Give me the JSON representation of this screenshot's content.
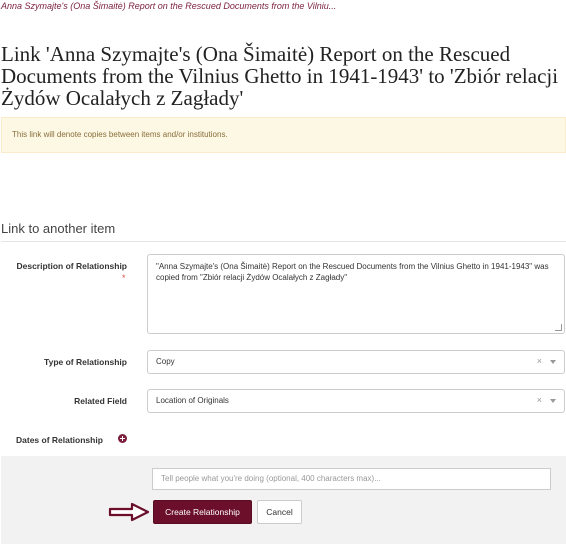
{
  "breadcrumb": "Anna Szymajte's (Ona Šimaitė) Report on the Rescued Documents from the Vilniu...",
  "page_title": "Link 'Anna Szymajte's (Ona Šimaitė) Report on the Rescued Documents from the Vilnius Ghetto in 1941-1943' to 'Zbiór relacji Żydów Ocalałych z Zagłady'",
  "alert_text": "This link will denote copies between items and/or institutions.",
  "section_heading": "Link to another item",
  "form": {
    "description_label": "Description of Relationship",
    "required_marker": "*",
    "description_value": "\"Anna Szymajte's (Ona Šimaitė) Report on the Rescued Documents from the Vilnius Ghetto in 1941-1943\" was copied from \"Zbiór relacji Żydów Ocalałych z Zagłady\"",
    "type_label": "Type of Relationship",
    "type_value": "Copy",
    "related_field_label": "Related Field",
    "related_field_value": "Location of Originals",
    "dates_label": "Dates of Relationship",
    "clear_glyph": "×"
  },
  "footer": {
    "log_placeholder": "Tell people what you're doing (optional, 400 characters max)...",
    "create_button": "Create Relationship",
    "cancel_button": "Cancel"
  },
  "colors": {
    "brand": "#6b0f2a",
    "annotation_arrow": "#6b0f2a",
    "alert_bg": "#fcf8e3"
  },
  "icons": [
    "plus-circle-icon",
    "chevron-down-icon",
    "clear-icon",
    "resize-grip-icon",
    "arrow-right-icon"
  ]
}
